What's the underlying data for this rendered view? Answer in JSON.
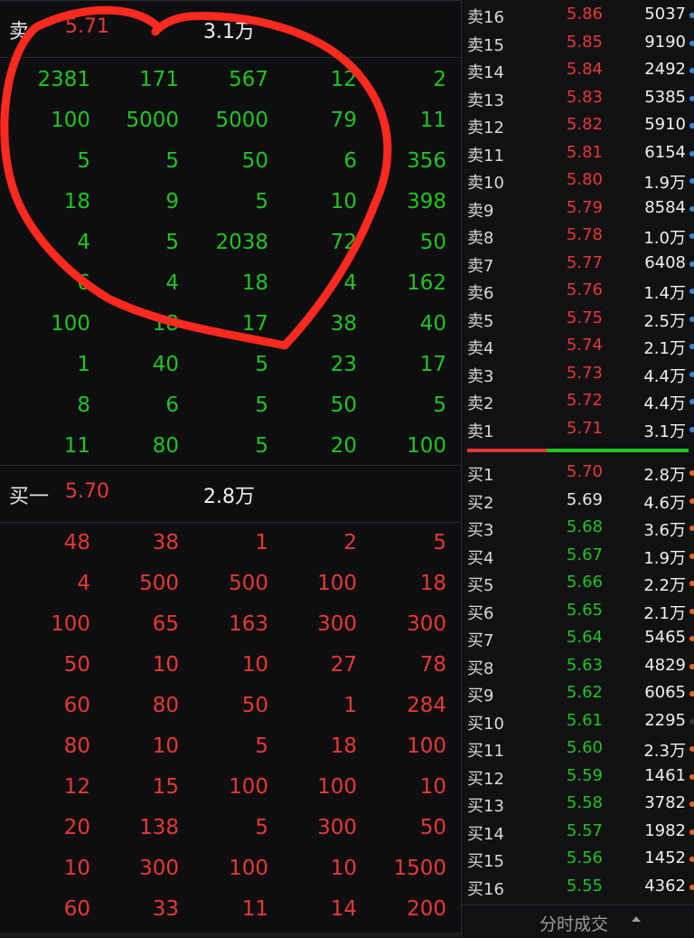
{
  "sell_header": {
    "label": "卖",
    "price": "5.71",
    "volume": "3.1万"
  },
  "sell_grid": [
    [
      "2381",
      "171",
      "567",
      "12",
      "2"
    ],
    [
      "100",
      "5000",
      "5000",
      "79",
      "11"
    ],
    [
      "5",
      "5",
      "50",
      "6",
      "356"
    ],
    [
      "18",
      "9",
      "5",
      "10",
      "398"
    ],
    [
      "4",
      "5",
      "2038",
      "72",
      "50"
    ],
    [
      "6",
      "4",
      "18",
      "4",
      "162"
    ],
    [
      "100",
      "18",
      "17",
      "38",
      "40"
    ],
    [
      "1",
      "40",
      "5",
      "23",
      "17"
    ],
    [
      "8",
      "6",
      "5",
      "50",
      "5"
    ],
    [
      "11",
      "80",
      "5",
      "20",
      "100"
    ]
  ],
  "buy_header": {
    "label": "买一",
    "price": "5.70",
    "volume": "2.8万"
  },
  "buy_grid": [
    [
      "48",
      "38",
      "1",
      "2",
      "5"
    ],
    [
      "4",
      "500",
      "500",
      "100",
      "18"
    ],
    [
      "100",
      "65",
      "163",
      "300",
      "300"
    ],
    [
      "50",
      "10",
      "10",
      "27",
      "78"
    ],
    [
      "60",
      "80",
      "50",
      "1",
      "284"
    ],
    [
      "80",
      "10",
      "5",
      "18",
      "100"
    ],
    [
      "12",
      "15",
      "100",
      "100",
      "10"
    ],
    [
      "20",
      "138",
      "5",
      "300",
      "50"
    ],
    [
      "10",
      "300",
      "100",
      "10",
      "1500"
    ],
    [
      "60",
      "33",
      "11",
      "14",
      "200"
    ]
  ],
  "order_book": {
    "asks": [
      {
        "name": "卖16",
        "price": "5.86",
        "volume": "5037",
        "color": "red"
      },
      {
        "name": "卖15",
        "price": "5.85",
        "volume": "9190",
        "color": "red"
      },
      {
        "name": "卖14",
        "price": "5.84",
        "volume": "2492",
        "color": "red"
      },
      {
        "name": "卖13",
        "price": "5.83",
        "volume": "5385",
        "color": "red"
      },
      {
        "name": "卖12",
        "price": "5.82",
        "volume": "5910",
        "color": "red"
      },
      {
        "name": "卖11",
        "price": "5.81",
        "volume": "6154",
        "color": "red"
      },
      {
        "name": "卖10",
        "price": "5.80",
        "volume": "1.9万",
        "color": "red"
      },
      {
        "name": "卖9",
        "price": "5.79",
        "volume": "8584",
        "color": "red"
      },
      {
        "name": "卖8",
        "price": "5.78",
        "volume": "1.0万",
        "color": "red"
      },
      {
        "name": "卖7",
        "price": "5.77",
        "volume": "6408",
        "color": "red"
      },
      {
        "name": "卖6",
        "price": "5.76",
        "volume": "1.4万",
        "color": "red"
      },
      {
        "name": "卖5",
        "price": "5.75",
        "volume": "2.5万",
        "color": "red"
      },
      {
        "name": "卖4",
        "price": "5.74",
        "volume": "2.1万",
        "color": "red"
      },
      {
        "name": "卖3",
        "price": "5.73",
        "volume": "4.4万",
        "color": "red"
      },
      {
        "name": "卖2",
        "price": "5.72",
        "volume": "4.4万",
        "color": "red"
      },
      {
        "name": "卖1",
        "price": "5.71",
        "volume": "3.1万",
        "color": "red"
      }
    ],
    "bids": [
      {
        "name": "买1",
        "price": "5.70",
        "volume": "2.8万",
        "color": "red"
      },
      {
        "name": "买2",
        "price": "5.69",
        "volume": "4.6万",
        "color": "white"
      },
      {
        "name": "买3",
        "price": "5.68",
        "volume": "3.6万",
        "color": "green"
      },
      {
        "name": "买4",
        "price": "5.67",
        "volume": "1.9万",
        "color": "green"
      },
      {
        "name": "买5",
        "price": "5.66",
        "volume": "2.2万",
        "color": "green"
      },
      {
        "name": "买6",
        "price": "5.65",
        "volume": "2.1万",
        "color": "green"
      },
      {
        "name": "买7",
        "price": "5.64",
        "volume": "5465",
        "color": "green"
      },
      {
        "name": "买8",
        "price": "5.63",
        "volume": "4829",
        "color": "green"
      },
      {
        "name": "买9",
        "price": "5.62",
        "volume": "6065",
        "color": "green"
      },
      {
        "name": "买10",
        "price": "5.61",
        "volume": "2295",
        "color": "green"
      },
      {
        "name": "买11",
        "price": "5.60",
        "volume": "2.3万",
        "color": "green"
      },
      {
        "name": "买12",
        "price": "5.59",
        "volume": "1461",
        "color": "green"
      },
      {
        "name": "买13",
        "price": "5.58",
        "volume": "3782",
        "color": "green"
      },
      {
        "name": "买14",
        "price": "5.57",
        "volume": "1982",
        "color": "green"
      },
      {
        "name": "买15",
        "price": "5.56",
        "volume": "1452",
        "color": "green"
      },
      {
        "name": "买16",
        "price": "5.55",
        "volume": "4362",
        "color": "green"
      }
    ],
    "ask_dot_color": "#3a86d6",
    "bid_dot_color": "#e8651f",
    "bid10_dot_color": "#333333"
  },
  "colors": {
    "up": "#e53935",
    "down": "#1fc51f",
    "annotation": "#ff2a1f"
  },
  "strength_bar": {
    "red_fraction": 0.36
  },
  "footer": {
    "label": "分时成交",
    "toggle_icon": "triangle-up-icon"
  }
}
